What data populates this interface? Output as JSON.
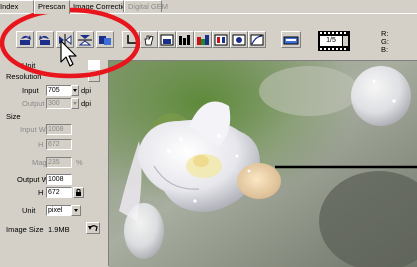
{
  "tabs": [
    {
      "label": "Index",
      "active": false,
      "disabled": false
    },
    {
      "label": "Prescan",
      "active": true,
      "disabled": false
    },
    {
      "label": "Image Correction",
      "active": false,
      "disabled": false
    },
    {
      "label": "Digital GEM",
      "active": false,
      "disabled": true
    }
  ],
  "toolbar": {
    "icons": [
      "rotate-left-icon",
      "rotate-right-icon",
      "flip-horizontal-icon",
      "flip-vertical-icon",
      "mirror-icon",
      "crop-tool-icon",
      "hand-tool-icon",
      "zoom-icon",
      "view-icon",
      "histogram-icon",
      "color-balance-icon",
      "color-channels-icon",
      "curves-icon"
    ],
    "frame_counter": "1/5",
    "rgb_labels": [
      "R:",
      "G:",
      "B:"
    ]
  },
  "left_panel": {
    "unit_top_label": "Unit",
    "resolution_label": "Resolution",
    "input_label": "Input",
    "input_value": "705",
    "input_unit": "dpi",
    "output_label": "Output",
    "output_value": "300",
    "output_unit": "dpi",
    "size_label": "Size",
    "input_w_label": "Input W",
    "input_w_value": "1008",
    "h1_label": "H",
    "h1_value": "672",
    "mag_label": "Mag",
    "mag_value": "235",
    "mag_unit": "%",
    "output_w_label": "Output W",
    "output_w_value": "1008",
    "h2_label": "H",
    "h2_value": "672",
    "unit_label": "Unit",
    "unit_value": "pixel",
    "image_size_label": "Image Size",
    "image_size_value": "1.9MB"
  },
  "colors": {
    "highlight_circle": "#e8151c",
    "window_face": "#d4d0c8"
  }
}
